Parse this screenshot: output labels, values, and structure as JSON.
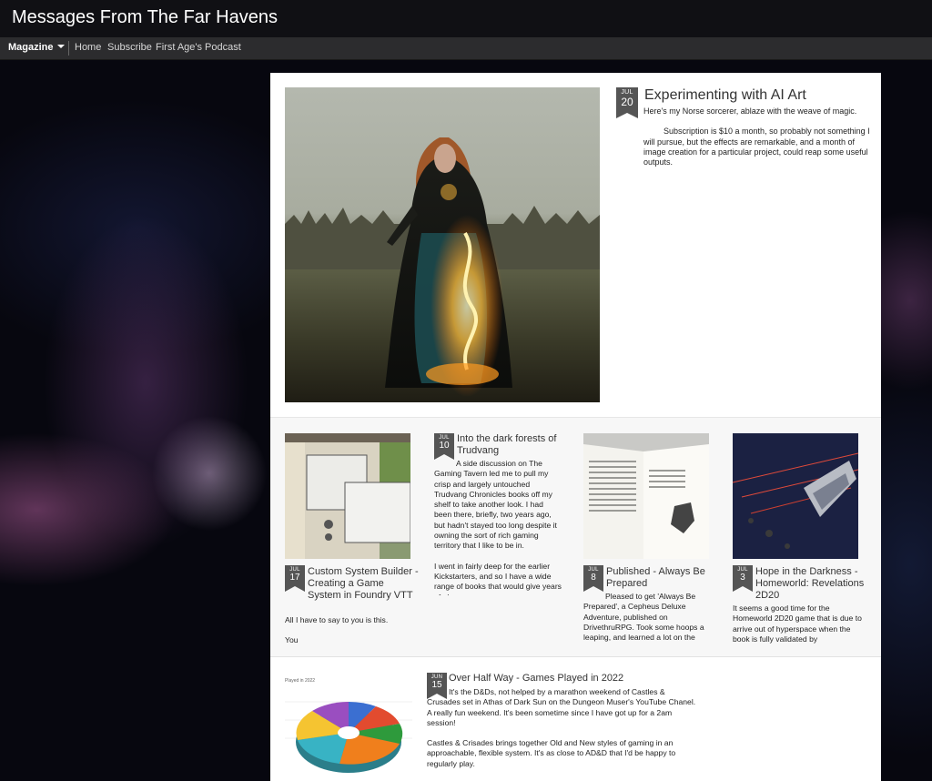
{
  "site": {
    "title": "Messages From The Far Havens"
  },
  "nav": {
    "brand": "Magazine",
    "links": [
      "Home",
      "Subscribe",
      "First Age's Podcast"
    ]
  },
  "featured": {
    "month": "JUL",
    "day": "20",
    "title": "Experimenting with AI Art",
    "paragraphs": [
      "Here's my Norse sorcerer, ablaze with the weave of magic.",
      "Subscription is $10 a month, so probably not something I will pursue, but the effects are remarkable, and a month of image creation for a particular project, could reap some useful outputs."
    ]
  },
  "cards": [
    {
      "month": "JUL",
      "day": "17",
      "title": "Custom System Builder - Creating a Game System in Foundry VTT",
      "paragraphs": [
        "All I have to say to you is this.",
        "You"
      ]
    },
    {
      "month": "JUL",
      "day": "10",
      "title": "Into the dark forests of Trudvang",
      "paragraphs": [
        "A side discussion on The Gaming Tavern led me to pull my crisp and largely untouched Trudvang Chronicles books off my shelf to take another look. I had been there, briefly, two years ago, but hadn't stayed too long despite it owning the sort of rich gaming territory that I like to be in.",
        "I went in fairly deep for the earlier Kickstarters, and so I have a wide range of books that would give years of play."
      ]
    },
    {
      "month": "JUL",
      "day": "8",
      "title": "Published - Always Be Prepared",
      "paragraphs": [
        "Pleased to get 'Always Be Prepared', a Cepheus Deluxe Adventure, published on DrivethruRPG. Took some hoops a leaping, and learned a lot on the"
      ]
    },
    {
      "month": "JUL",
      "day": "3",
      "title": "Hope in the Darkness - Homeworld: Revelations 2D20",
      "paragraphs": [
        "It seems a good time for the Homeworld 2D20 game that is due to arrive out of hyperspace when the book is fully validated by"
      ]
    }
  ],
  "last_post": {
    "month": "JUN",
    "day": "15",
    "title": "Over Half Way - Games Played in 2022",
    "chart_caption": "Played in 2022",
    "paragraphs": [
      "It's the D&Ds, not helped by a marathon weekend of Castles & Crusades set in Athas of Dark Sun on the Dungeon Muser's YouTube Chanel. A really fun weekend. It's been sometime since I have got up for a 2am session!",
      "Castles & Crisades brings together Old and New styles of gaming in an approachable, flexible system. It's as close to AD&D that I'd be happy to regularly play."
    ]
  },
  "colors": {
    "header_bg": "#101014",
    "navbar_bg": "#2c2c2e",
    "date_badge": "#555555",
    "content_bg": "#ffffff"
  }
}
